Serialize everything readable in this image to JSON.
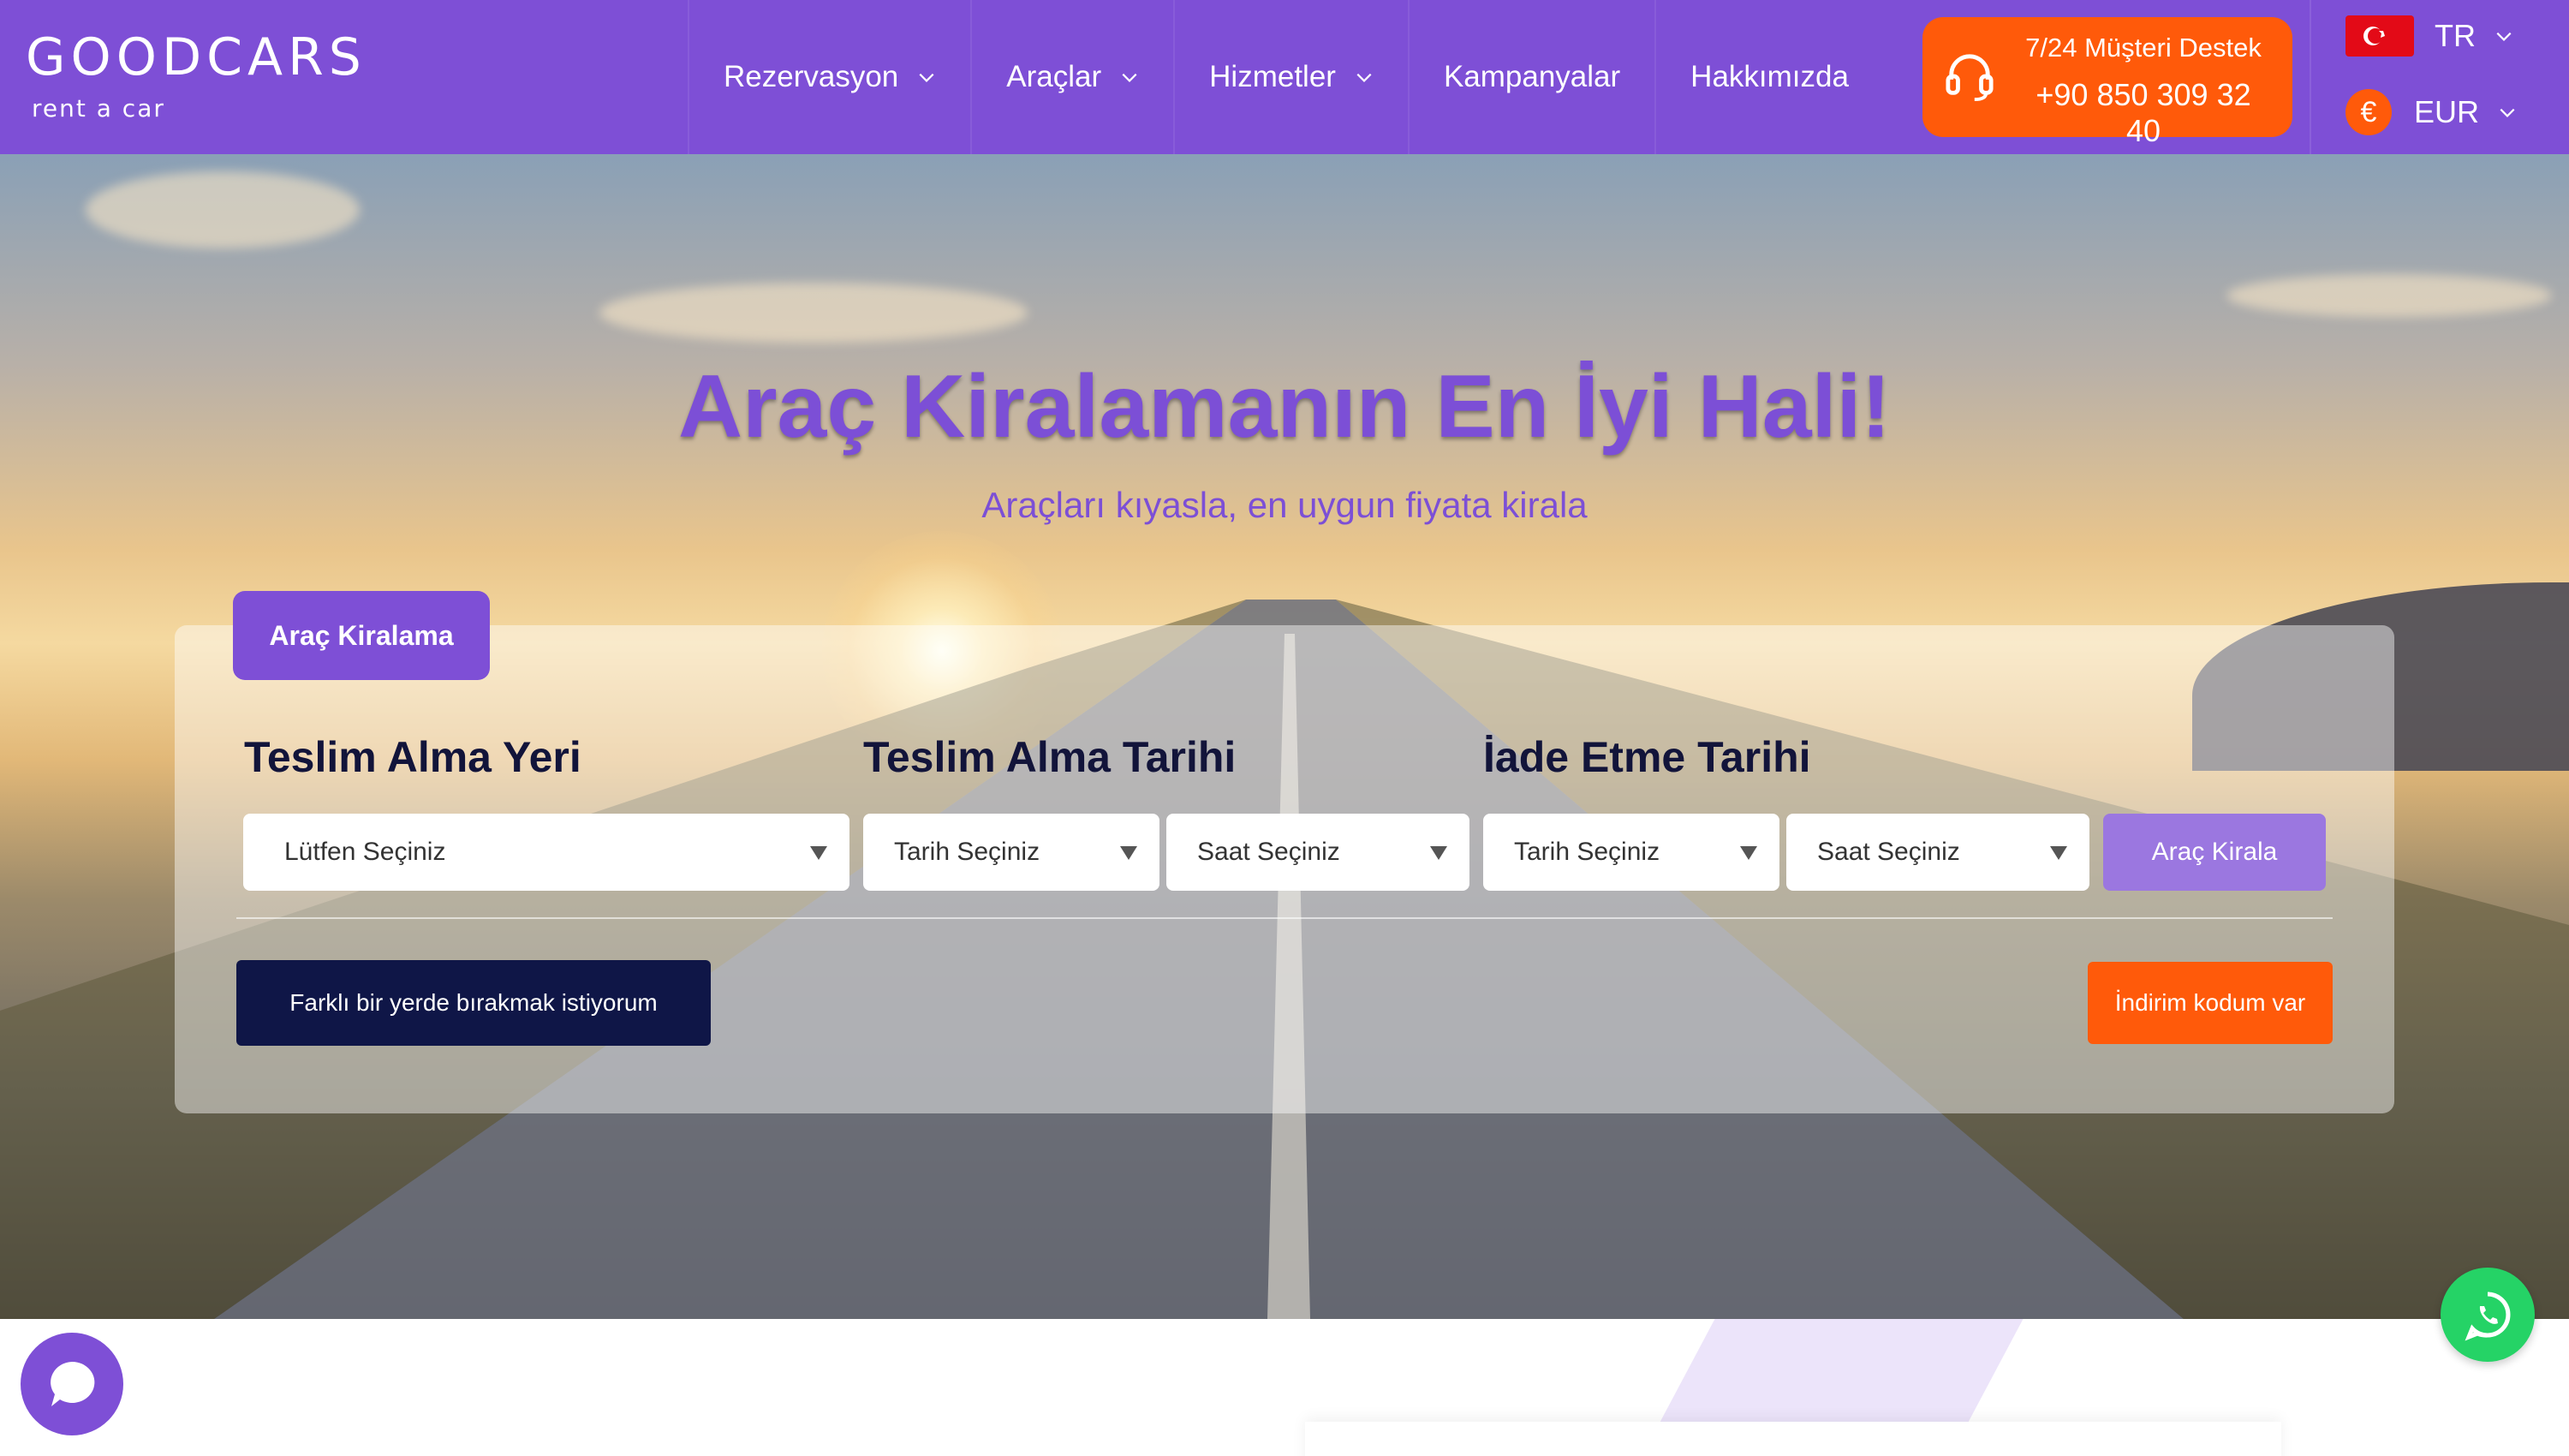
{
  "brand": {
    "name": "GOODCARS",
    "tagline": "rent a car",
    "primary_color": "#7e4fd6",
    "accent_color": "#ff5a0a",
    "navy_color": "#0f1647"
  },
  "nav": {
    "items": [
      {
        "label": "Rezervasyon",
        "has_dropdown": true
      },
      {
        "label": "Araçlar",
        "has_dropdown": true
      },
      {
        "label": "Hizmetler",
        "has_dropdown": true
      },
      {
        "label": "Kampanyalar",
        "has_dropdown": false
      },
      {
        "label": "Hakkımızda",
        "has_dropdown": false
      }
    ]
  },
  "support": {
    "label": "7/24 Müşteri Destek",
    "phone": "+90 850 309 32 40",
    "icon": "headset-icon"
  },
  "locale": {
    "language": "TR",
    "language_icon": "turkey-flag-icon",
    "currency": "EUR",
    "currency_symbol": "€"
  },
  "hero": {
    "title": "Araç Kiralamanın En İyi Hali!",
    "subtitle": "Araçları kıyasla, en uygun fiyata kirala"
  },
  "search": {
    "tab_label": "Araç Kiralama",
    "pickup_location": {
      "label": "Teslim Alma Yeri",
      "placeholder": "Lütfen Seçiniz"
    },
    "pickup_date": {
      "label": "Teslim Alma Tarihi",
      "date_placeholder": "Tarih Seçiniz",
      "time_placeholder": "Saat Seçiniz"
    },
    "return_date": {
      "label": "İade Etme Tarihi",
      "date_placeholder": "Tarih Seçiniz",
      "time_placeholder": "Saat Seçiniz"
    },
    "submit_label": "Araç Kirala",
    "different_dropoff_label": "Farklı bir yerde bırakmak istiyorum",
    "discount_code_label": "İndirim kodum var"
  },
  "floating": {
    "chat_icon": "chat-bubble-icon",
    "whatsapp_icon": "whatsapp-icon"
  }
}
